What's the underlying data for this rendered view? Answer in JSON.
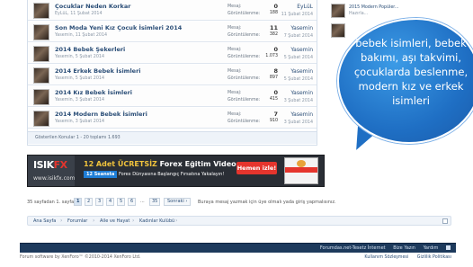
{
  "threads": [
    {
      "title": "Çocuklar Neden Korkar",
      "meta": "EyLüL, 11 Şubat 2014",
      "replies_label": "Mesaj:",
      "replies": "0",
      "views_label": "Görüntülenme:",
      "views": "188",
      "last_user": "EyLüL",
      "last_date": "11 Şubat 2014"
    },
    {
      "title": "Son Moda Yeni Kız Çocuk İsimleri 2014",
      "meta": "Yasemin, 11 Şubat 2014",
      "replies_label": "Mesaj:",
      "replies": "11",
      "views_label": "Görüntülenme:",
      "views": "382",
      "last_user": "Yasemin",
      "last_date": "7 Şubat 2014"
    },
    {
      "title": "2014 Bebek Şekerleri",
      "meta": "Yasemin, 5 Şubat 2014",
      "replies_label": "Mesaj:",
      "replies": "0",
      "views_label": "Görüntülenme:",
      "views": "1.073",
      "last_user": "Yasemin",
      "last_date": "5 Şubat 2014"
    },
    {
      "title": "2014 Erkek Bebek İsimleri",
      "meta": "Yasemin, 5 Şubat 2014",
      "replies_label": "Mesaj:",
      "replies": "8",
      "views_label": "Görüntülenme:",
      "views": "897",
      "last_user": "Yasemin",
      "last_date": "5 Şubat 2014"
    },
    {
      "title": "2014 Kız Bebek İsimleri",
      "meta": "Yasemin, 3 Şubat 2014",
      "replies_label": "Mesaj:",
      "replies": "0",
      "views_label": "Görüntülenme:",
      "views": "415",
      "last_user": "Yasemin",
      "last_date": "3 Şubat 2014"
    },
    {
      "title": "2014 Modern Bebek İsimleri",
      "meta": "Yasemin, 3 Şubat 2014",
      "replies_label": "Mesaj:",
      "replies": "7",
      "views_label": "Görüntülenme:",
      "views": "910",
      "last_user": "Yasemin",
      "last_date": "3 Şubat 2014"
    }
  ],
  "list_footer": "Gösterilen Konular 1 - 20 toplamı 1.693",
  "sidebar": [
    {
      "line1": "2015 Modern Popüler...",
      "line2": "Hazırla..."
    },
    {
      "line1": "...",
      "line2": ""
    }
  ],
  "bubble_text": "bebek isimleri, bebek bakımı, aşı takvimi, çocuklarda beslenme, modern kız ve erkek isimleri",
  "ad": {
    "brand_a": "ISIK",
    "brand_b": "FX",
    "url": "www.isikfx.com",
    "headline_a": "12 Adet ÜCRETSİZ",
    "headline_b": " Forex Eğitim Videosu",
    "sub_box": "12 Seansta",
    "sub_rest": " Forex Dünyasına Başlangıç Fırsatına Yakalayın!",
    "button": "Hemen izle!"
  },
  "pager": {
    "summary": "35 sayfadan 1. sayfa",
    "pages": [
      "1",
      "2",
      "3",
      "4",
      "5",
      "6"
    ],
    "dots": "...",
    "last": "35",
    "next": "Sonraki ›"
  },
  "notice": "Buraya mesaj yazmak için üye olmalı yada giriş yapmalısınız.",
  "breadcrumb": [
    "Ana Sayfa",
    "Forumlar",
    "Aile ve Hayat",
    "Kadınlar Kulübü"
  ],
  "footer_links": [
    "Forumdas.net-Tesetz İnternet",
    "Bize Yazın",
    "Yardım"
  ],
  "copyright": "Forum software by XenForo™ ©2010-2014 XenForo Ltd.",
  "terms": [
    "Kullanım Sözleşmesi",
    "Gizlilik Politikası"
  ]
}
